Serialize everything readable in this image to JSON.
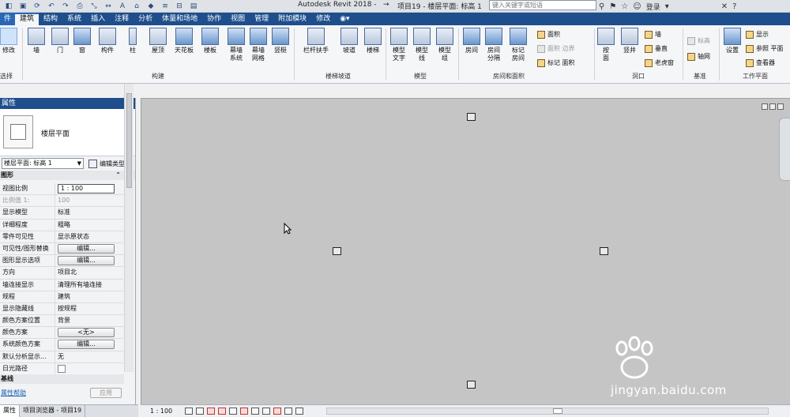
{
  "title_bar": {
    "app_title": "Autodesk Revit 2018 -",
    "separator": "→",
    "document_title": "项目19 - 楼层平面: 标高 1",
    "search_placeholder": "键入关键字或短语",
    "login_label": "登录",
    "icons": [
      "open-icon",
      "save-icon",
      "sync-icon",
      "undo-icon",
      "redo-icon",
      "print-icon",
      "measure-icon",
      "dimension-icon",
      "tag-icon",
      "3d-view-icon",
      "section-icon",
      "thin-lines-icon",
      "close-hidden-icon",
      "switch-windows-icon"
    ]
  },
  "menu": {
    "tabs": [
      "件",
      "建筑",
      "结构",
      "系统",
      "插入",
      "注释",
      "分析",
      "体量和场地",
      "协作",
      "视图",
      "管理",
      "附加模块",
      "修改"
    ],
    "active_tab": "建筑"
  },
  "ribbon": {
    "select": {
      "modify_label": "修改",
      "group_label": "选择"
    },
    "build_buttons": [
      "墙",
      "门",
      "窗",
      "构件",
      "柱",
      "屋顶",
      "天花板",
      "楼板",
      "幕墙\n系统",
      "幕墙\n网格",
      "竖梃"
    ],
    "build_group_label": "构建",
    "stair_buttons": [
      "栏杆扶手",
      "坡道",
      "楼梯"
    ],
    "stair_group_label": "楼梯坡道",
    "model_buttons": [
      "模型\n文字",
      "模型\n线",
      "模型\n组"
    ],
    "model_group_label": "模型",
    "room_buttons": [
      "房间",
      "房间\n分隔",
      "标记\n房间"
    ],
    "room_small": [
      {
        "label": "面积",
        "enabled": true
      },
      {
        "label": "面积 边界",
        "enabled": false
      },
      {
        "label": "标记 面积",
        "enabled": true
      }
    ],
    "room_group_label": "房间和面积",
    "opening_buttons": [
      "按\n面",
      "竖井"
    ],
    "opening_small": [
      "墙",
      "垂直",
      "老虎窗"
    ],
    "opening_group_label": "洞口",
    "datum_small": [
      {
        "label": "标高",
        "enabled": false
      },
      {
        "label": "轴网",
        "enabled": true
      }
    ],
    "datum_group_label": "基准",
    "workplane_button": "设置",
    "workplane_small": [
      "显示",
      "参照 平面",
      "查看器"
    ],
    "workplane_group_label": "工作平面"
  },
  "properties": {
    "header": "属性",
    "type_name": "楼层平面",
    "view_selector": "楼层平面: 标高 1",
    "edit_type_label": "编辑类型",
    "category": "图形",
    "rows": [
      {
        "name": "视图比例",
        "value": "1 : 100",
        "kind": "input"
      },
      {
        "name": "比例值 1:",
        "value": "100",
        "kind": "disabled"
      },
      {
        "name": "显示模型",
        "value": "标准",
        "kind": "text"
      },
      {
        "name": "详细程度",
        "value": "粗略",
        "kind": "text"
      },
      {
        "name": "零件可见性",
        "value": "显示原状态",
        "kind": "text"
      },
      {
        "name": "可见性/图形替换",
        "value": "编辑...",
        "kind": "button"
      },
      {
        "name": "图形显示选项",
        "value": "编辑...",
        "kind": "button"
      },
      {
        "name": "方向",
        "value": "项目北",
        "kind": "text"
      },
      {
        "name": "墙连接显示",
        "value": "清理所有墙连接",
        "kind": "text"
      },
      {
        "name": "规程",
        "value": "建筑",
        "kind": "text"
      },
      {
        "name": "显示隐藏线",
        "value": "按规程",
        "kind": "text"
      },
      {
        "name": "颜色方案位置",
        "value": "背景",
        "kind": "text"
      },
      {
        "name": "颜色方案",
        "value": "<无>",
        "kind": "button"
      },
      {
        "name": "系统颜色方案",
        "value": "编辑...",
        "kind": "button"
      },
      {
        "name": "默认分析显示...",
        "value": "无",
        "kind": "text"
      },
      {
        "name": "日光路径",
        "value": "",
        "kind": "checkbox"
      }
    ],
    "sub_category": "基线",
    "help_link": "属性帮助",
    "apply_label": "应用"
  },
  "bottom_tabs": [
    "属性",
    "项目浏览器 - 项目19"
  ],
  "status": {
    "scale": "1 : 100"
  },
  "watermark": {
    "text": "jingyan.baidu.com"
  }
}
